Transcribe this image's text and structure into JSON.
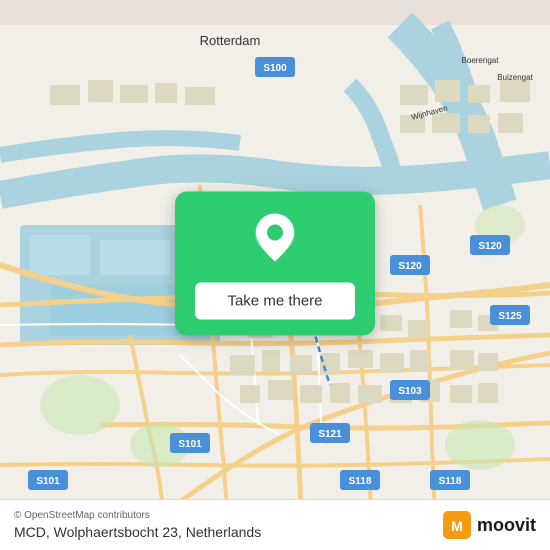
{
  "map": {
    "alt": "OpenStreetMap of Rotterdam area"
  },
  "action_card": {
    "button_label": "Take me there"
  },
  "bottom_bar": {
    "copyright": "© OpenStreetMap contributors",
    "location": "MCD, Wolphaertsbocht 23, Netherlands",
    "logo_text": "moovit"
  }
}
